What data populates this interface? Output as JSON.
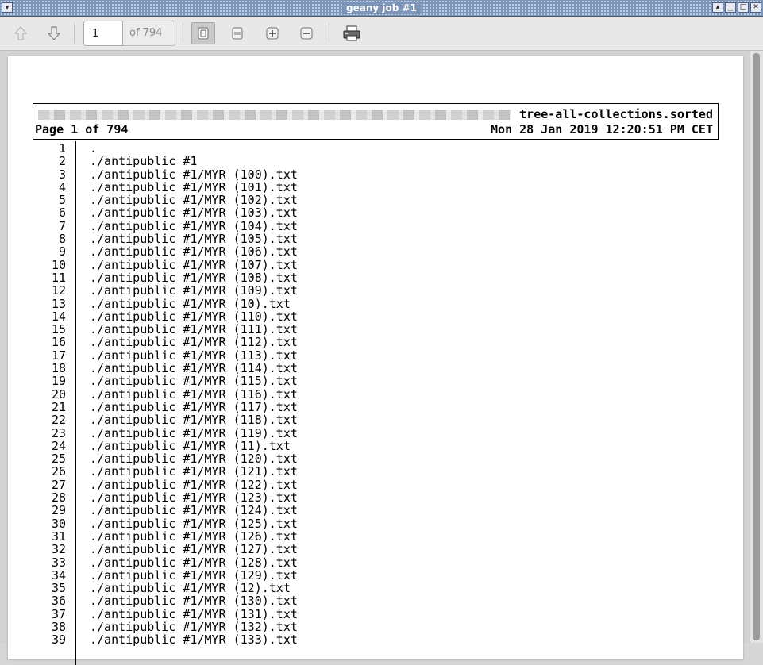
{
  "window": {
    "title": "geany job #1"
  },
  "toolbar": {
    "page_value": "1",
    "page_total": "of 794"
  },
  "page_header": {
    "filename": "tree-all-collections.sorted",
    "page_label": "Page 1 of 794",
    "timestamp": "Mon 28 Jan 2019 12:20:51 PM CET"
  },
  "lines": [
    {
      "n": "1",
      "t": "."
    },
    {
      "n": "2",
      "t": "./antipublic #1"
    },
    {
      "n": "3",
      "t": "./antipublic #1/MYR (100).txt"
    },
    {
      "n": "4",
      "t": "./antipublic #1/MYR (101).txt"
    },
    {
      "n": "5",
      "t": "./antipublic #1/MYR (102).txt"
    },
    {
      "n": "6",
      "t": "./antipublic #1/MYR (103).txt"
    },
    {
      "n": "7",
      "t": "./antipublic #1/MYR (104).txt"
    },
    {
      "n": "8",
      "t": "./antipublic #1/MYR (105).txt"
    },
    {
      "n": "9",
      "t": "./antipublic #1/MYR (106).txt"
    },
    {
      "n": "10",
      "t": "./antipublic #1/MYR (107).txt"
    },
    {
      "n": "11",
      "t": "./antipublic #1/MYR (108).txt"
    },
    {
      "n": "12",
      "t": "./antipublic #1/MYR (109).txt"
    },
    {
      "n": "13",
      "t": "./antipublic #1/MYR (10).txt"
    },
    {
      "n": "14",
      "t": "./antipublic #1/MYR (110).txt"
    },
    {
      "n": "15",
      "t": "./antipublic #1/MYR (111).txt"
    },
    {
      "n": "16",
      "t": "./antipublic #1/MYR (112).txt"
    },
    {
      "n": "17",
      "t": "./antipublic #1/MYR (113).txt"
    },
    {
      "n": "18",
      "t": "./antipublic #1/MYR (114).txt"
    },
    {
      "n": "19",
      "t": "./antipublic #1/MYR (115).txt"
    },
    {
      "n": "20",
      "t": "./antipublic #1/MYR (116).txt"
    },
    {
      "n": "21",
      "t": "./antipublic #1/MYR (117).txt"
    },
    {
      "n": "22",
      "t": "./antipublic #1/MYR (118).txt"
    },
    {
      "n": "23",
      "t": "./antipublic #1/MYR (119).txt"
    },
    {
      "n": "24",
      "t": "./antipublic #1/MYR (11).txt"
    },
    {
      "n": "25",
      "t": "./antipublic #1/MYR (120).txt"
    },
    {
      "n": "26",
      "t": "./antipublic #1/MYR (121).txt"
    },
    {
      "n": "27",
      "t": "./antipublic #1/MYR (122).txt"
    },
    {
      "n": "28",
      "t": "./antipublic #1/MYR (123).txt"
    },
    {
      "n": "29",
      "t": "./antipublic #1/MYR (124).txt"
    },
    {
      "n": "30",
      "t": "./antipublic #1/MYR (125).txt"
    },
    {
      "n": "31",
      "t": "./antipublic #1/MYR (126).txt"
    },
    {
      "n": "32",
      "t": "./antipublic #1/MYR (127).txt"
    },
    {
      "n": "33",
      "t": "./antipublic #1/MYR (128).txt"
    },
    {
      "n": "34",
      "t": "./antipublic #1/MYR (129).txt"
    },
    {
      "n": "35",
      "t": "./antipublic #1/MYR (12).txt"
    },
    {
      "n": "36",
      "t": "./antipublic #1/MYR (130).txt"
    },
    {
      "n": "37",
      "t": "./antipublic #1/MYR (131).txt"
    },
    {
      "n": "38",
      "t": "./antipublic #1/MYR (132).txt"
    },
    {
      "n": "39",
      "t": "./antipublic #1/MYR (133).txt"
    }
  ]
}
